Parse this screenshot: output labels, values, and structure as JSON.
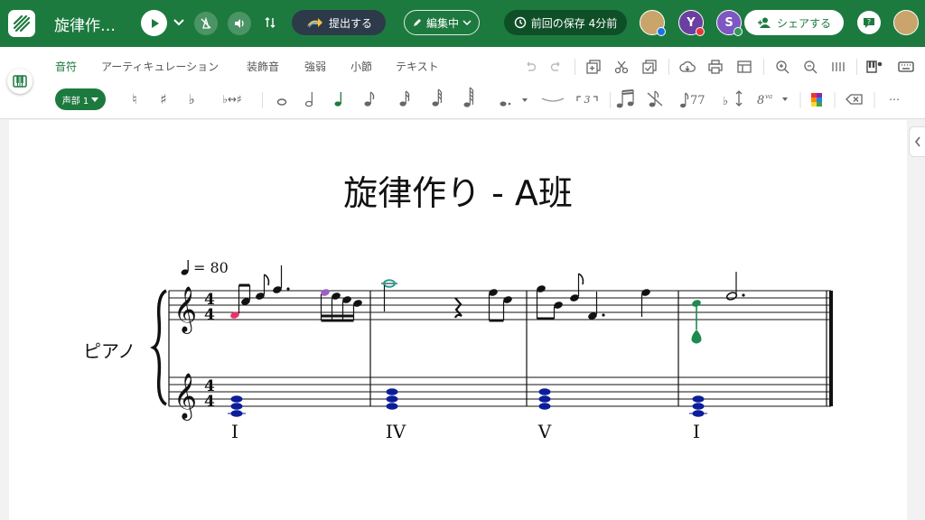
{
  "header": {
    "title": "旋律作…",
    "submit_label": "提出する",
    "edit_label": "編集中",
    "saved_label": "前回の保存 4分前",
    "share_label": "シェアする",
    "avatars": [
      {
        "letter": "",
        "color": "#c9a56b",
        "status": "#1a73e8"
      },
      {
        "letter": "Y",
        "color": "#6a3fa0",
        "status": "#e53935"
      },
      {
        "letter": "S",
        "color": "#7e57c2",
        "status": "#2e9b5b"
      },
      {
        "letter": "",
        "color": "#c9a56b",
        "status": ""
      }
    ]
  },
  "toolbar": {
    "tabs": [
      "音符",
      "アーティキュレーション",
      "装飾音",
      "強弱",
      "小節",
      "テキスト"
    ],
    "active_tab": "音符",
    "voice_label": "声部 1",
    "accidentals": [
      "♮",
      "♯",
      "♭",
      "♭↔♯"
    ],
    "icons": [
      "undo-icon",
      "redo-icon",
      "add-measure-icon",
      "cut-icon",
      "copy-icon",
      "cloud-icon",
      "print-icon",
      "layout-icon",
      "zoom-in-icon",
      "zoom-out-icon",
      "page-view-icon",
      "instrument-icon",
      "keyboard-icon"
    ]
  },
  "score": {
    "title": "旋律作り - A班",
    "tempo": "= 80",
    "instrument": "ピアノ",
    "chords": [
      "I",
      "IV",
      "V",
      "I"
    ]
  },
  "colors": {
    "brand": "#1d7a3f",
    "chord_notes": "#0b1d9a",
    "highlight_pink": "#e8336a",
    "highlight_purple": "#9c5fc7",
    "highlight_teal": "#1f9e8e",
    "highlight_green": "#1d8a4f"
  }
}
